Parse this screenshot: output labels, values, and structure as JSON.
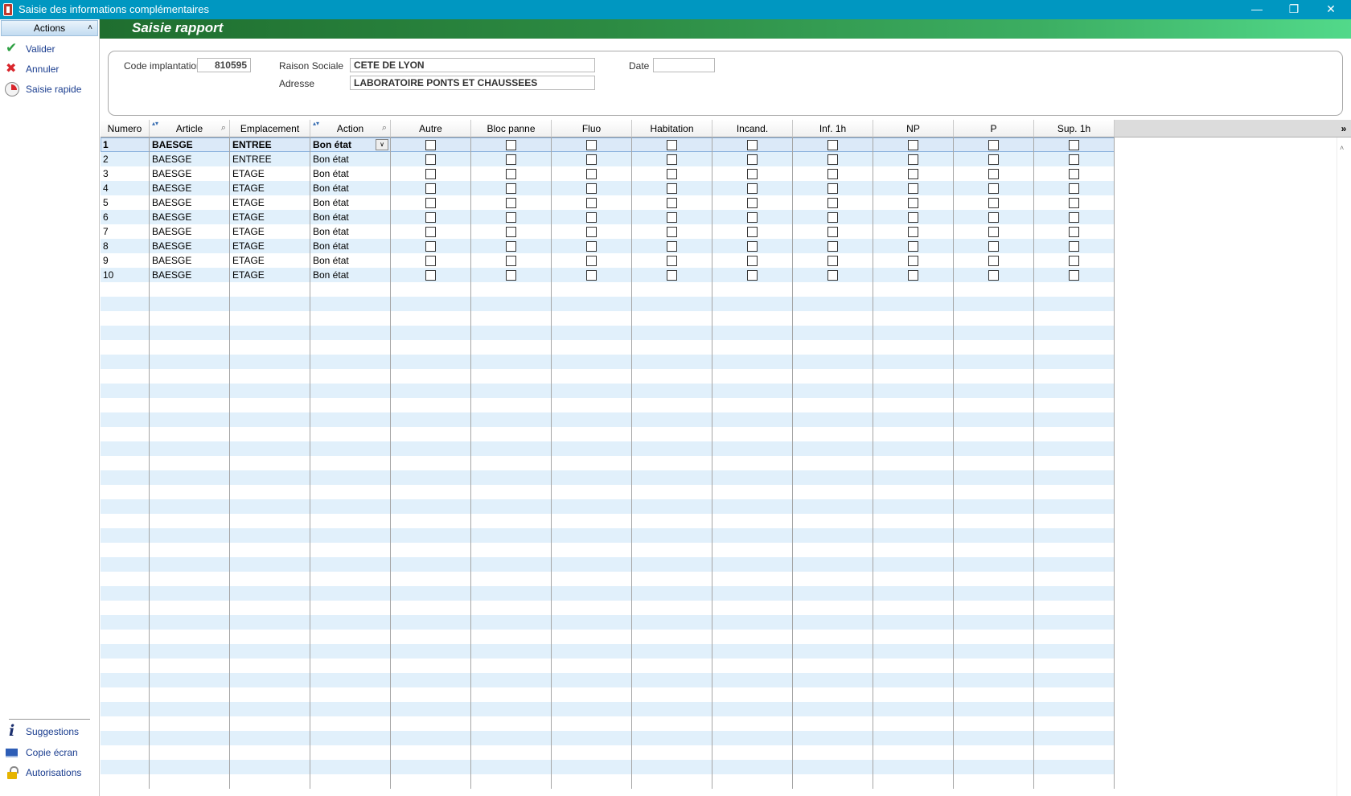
{
  "window": {
    "title": "Saisie des informations complémentaires",
    "minimize": "—",
    "restore": "❐",
    "close": "✕"
  },
  "sidebar": {
    "header": "Actions",
    "top_items": [
      {
        "label": "Valider",
        "icon": "check-icon"
      },
      {
        "label": "Annuler",
        "icon": "cross-icon"
      },
      {
        "label": "Saisie rapide",
        "icon": "clock-icon"
      }
    ],
    "bottom_items": [
      {
        "label": "Suggestions",
        "icon": "info-icon"
      },
      {
        "label": "Copie écran",
        "icon": "screen-icon"
      },
      {
        "label": "Autorisations",
        "icon": "lock-icon"
      }
    ]
  },
  "banner": {
    "title": "Saisie rapport"
  },
  "form": {
    "code_label": "Code implantation",
    "code_value": "810595",
    "raison_label": "Raison Sociale",
    "raison_value": "CETE DE LYON",
    "adresse_label": "Adresse",
    "adresse_value": "LABORATOIRE PONTS ET CHAUSSEES",
    "date_label": "Date",
    "date_value": ""
  },
  "grid": {
    "columns": [
      "Numero",
      "Article",
      "Emplacement",
      "Action",
      "Autre",
      "Bloc panne",
      "Fluo",
      "Habitation",
      "Incand.",
      "Inf. 1h",
      "NP",
      "P",
      "Sup. 1h"
    ],
    "rows": [
      {
        "numero": "1",
        "article": "BAESGE",
        "emplacement": "ENTREE",
        "action": "Bon état"
      },
      {
        "numero": "2",
        "article": "BAESGE",
        "emplacement": "ENTREE",
        "action": "Bon état"
      },
      {
        "numero": "3",
        "article": "BAESGE",
        "emplacement": "ETAGE",
        "action": "Bon état"
      },
      {
        "numero": "4",
        "article": "BAESGE",
        "emplacement": "ETAGE",
        "action": "Bon état"
      },
      {
        "numero": "5",
        "article": "BAESGE",
        "emplacement": "ETAGE",
        "action": "Bon état"
      },
      {
        "numero": "6",
        "article": "BAESGE",
        "emplacement": "ETAGE",
        "action": "Bon état"
      },
      {
        "numero": "7",
        "article": "BAESGE",
        "emplacement": "ETAGE",
        "action": "Bon état"
      },
      {
        "numero": "8",
        "article": "BAESGE",
        "emplacement": "ETAGE",
        "action": "Bon état"
      },
      {
        "numero": "9",
        "article": "BAESGE",
        "emplacement": "ETAGE",
        "action": "Bon état"
      },
      {
        "numero": "10",
        "article": "BAESGE",
        "emplacement": "ETAGE",
        "action": "Bon état"
      }
    ],
    "expand_glyph": "»"
  }
}
